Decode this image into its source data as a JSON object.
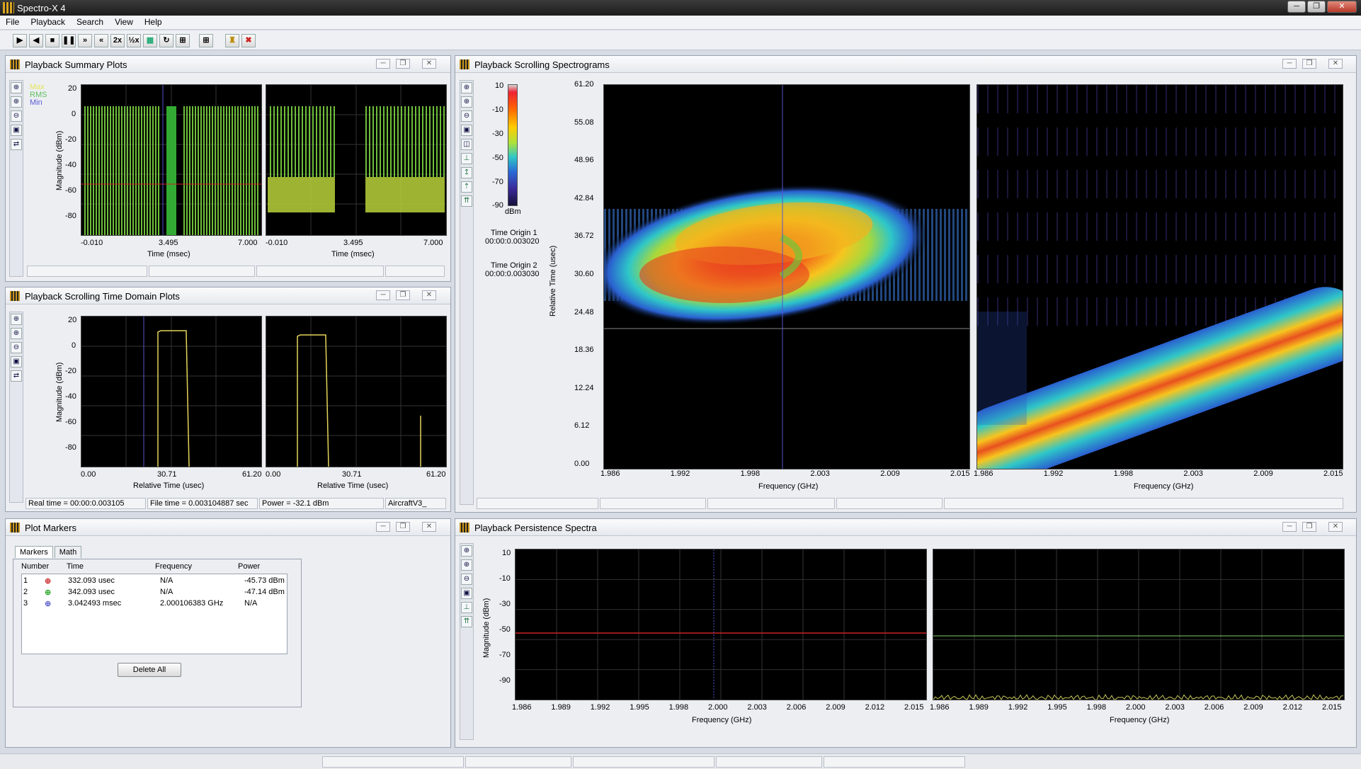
{
  "app": {
    "title": "Spectro-X 4"
  },
  "menu": [
    "File",
    "Playback",
    "Search",
    "View",
    "Help"
  ],
  "toolbar": {
    "buttons": [
      "play",
      "reverse",
      "stop",
      "pause",
      "fast-forward",
      "rewind",
      "2x",
      "half-speed",
      "screenshot",
      "loop",
      "region",
      "grid",
      "find",
      "clear"
    ],
    "labels": {
      "two_x": "2x",
      "half": "½x"
    }
  },
  "summary": {
    "title": "Playback Summary Plots",
    "legend": [
      "Max",
      "RMS",
      "Min"
    ],
    "ylabel": "Magnitude (dBm)",
    "xlabel": "Time (msec)",
    "yticks": [
      "20",
      "0",
      "-20",
      "-40",
      "-60",
      "-80"
    ],
    "xticks": [
      "-0.010",
      "3.495",
      "7.000"
    ]
  },
  "timedomain": {
    "title": "Playback Scrolling Time Domain Plots",
    "ylabel": "Magnitude (dBm)",
    "xlabel": "Relative Time (usec)",
    "yticks": [
      "20",
      "0",
      "-20",
      "-40",
      "-60",
      "-80"
    ],
    "xticks": [
      "0.00",
      "30.71",
      "61.20"
    ],
    "status": {
      "real_time": "Real time = 00:00:0.003105",
      "file_time": "File time = 0.003104887 sec",
      "power": "Power = -32.1 dBm",
      "file": "AircraftV3_"
    }
  },
  "markers": {
    "title": "Plot Markers",
    "tabs": [
      "Markers",
      "Math"
    ],
    "headers": [
      "Number",
      "Time",
      "Frequency",
      "Power"
    ],
    "rows": [
      [
        "1",
        "332.093 usec",
        "N/A",
        "-45.73 dBm"
      ],
      [
        "2",
        "342.093 usec",
        "N/A",
        "-47.14 dBm"
      ],
      [
        "3",
        "3.042493 msec",
        "2.000106383 GHz",
        "N/A"
      ]
    ],
    "colors": [
      "#cc3333",
      "#33aa33",
      "#6666cc"
    ],
    "delete_all": "Delete All"
  },
  "spectro": {
    "title": "Playback Scrolling Spectrograms",
    "colorbar_ticks": [
      "10",
      "-10",
      "-30",
      "-50",
      "-70",
      "-90"
    ],
    "colorbar_unit": "dBm",
    "origin1_label": "Time Origin 1",
    "origin1_value": "00:00:0.003020",
    "origin2_label": "Time Origin 2",
    "origin2_value": "00:00:0.003030",
    "ylabel": "Relative Time (usec)",
    "yticks": [
      "61.20",
      "55.08",
      "48.96",
      "42.84",
      "36.72",
      "30.60",
      "24.48",
      "18.36",
      "12.24",
      "6.12",
      "0.00"
    ],
    "xlabel": "Frequency (GHz)",
    "xticks": [
      "1.986",
      "1.992",
      "1.998",
      "2.003",
      "2.009",
      "2.015"
    ]
  },
  "persistence": {
    "title": "Playback Persistence Spectra",
    "ylabel": "Magnitude (dBm)",
    "yticks": [
      "10",
      "-10",
      "-30",
      "-50",
      "-70",
      "-90"
    ],
    "xlabel": "Frequency (GHz)",
    "xticks": [
      "1.986",
      "1.989",
      "1.992",
      "1.995",
      "1.998",
      "2.000",
      "2.003",
      "2.006",
      "2.009",
      "2.012",
      "2.015"
    ]
  },
  "window_controls": {
    "minimize": "─",
    "restore": "❐",
    "close": "✕"
  }
}
